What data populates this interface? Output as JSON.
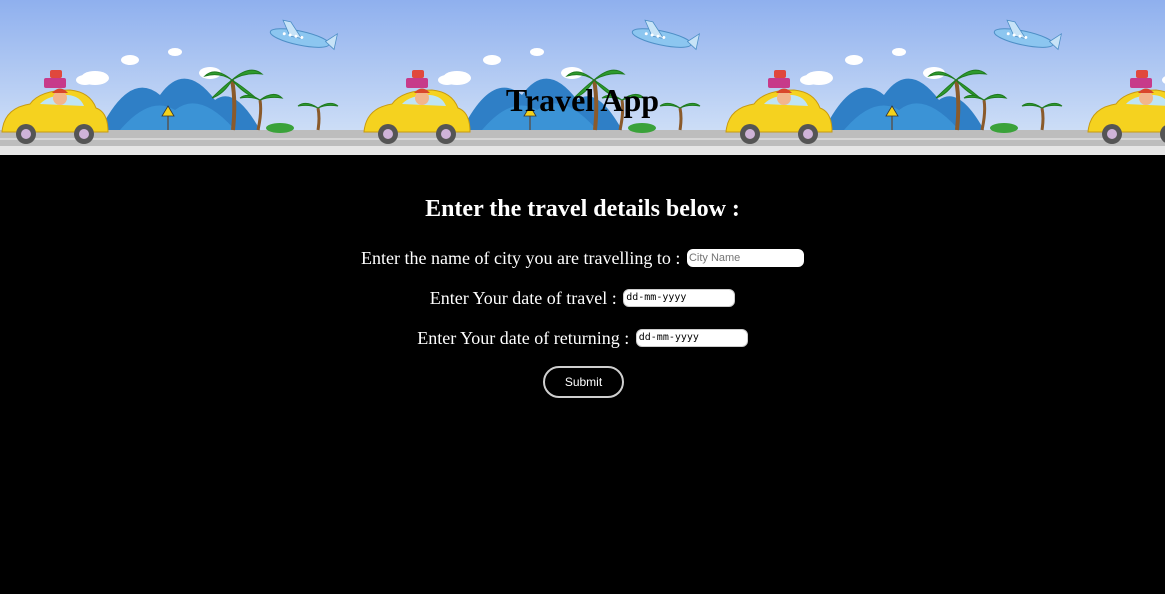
{
  "header": {
    "title": "Travel App"
  },
  "form": {
    "heading": "Enter the travel details below :",
    "city": {
      "label": "Enter the name of city you are travelling to :",
      "placeholder": "City Name",
      "value": ""
    },
    "travel_date": {
      "label": "Enter Your date of travel :",
      "value": "dd-mm-yyyy"
    },
    "return_date": {
      "label": "Enter Your date of returning :",
      "value": "dd-mm-yyyy"
    },
    "submit_label": "Submit"
  },
  "colors": {
    "page_background": "#000000",
    "sky": "#9db8ec",
    "road": "#bdbdbd",
    "car": "#f5d21f",
    "mountains": "#2f7fc6",
    "palm": "#2e9a2e"
  },
  "icons": [
    "airplane-icon",
    "car-icon",
    "palm-tree-icon",
    "mountain-icon",
    "cloud-icon",
    "road-sign-icon"
  ]
}
